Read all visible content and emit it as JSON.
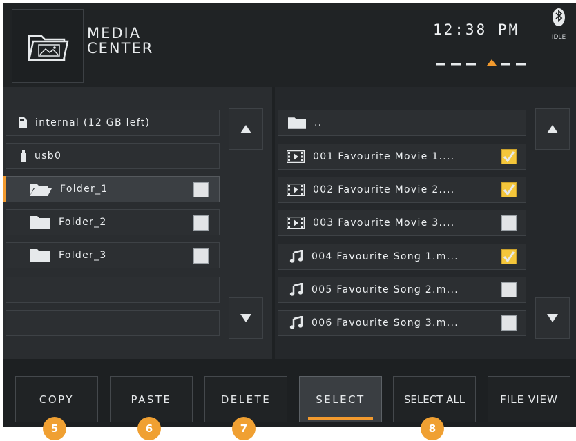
{
  "header": {
    "title_line1": "MEDIA",
    "title_line2": "CENTER",
    "time": "12:38 PM",
    "bluetooth_status": "IDLE",
    "app_icon": "folder-image-icon"
  },
  "left_panel": {
    "items": [
      {
        "label": "internal (12 GB left)",
        "icon": "sd-card-icon"
      },
      {
        "label": "usb0",
        "icon": "usb-drive-icon"
      },
      {
        "label": "Folder_1",
        "icon": "folder-open-icon",
        "checked": false,
        "active": true
      },
      {
        "label": "Folder_2",
        "icon": "folder-icon",
        "checked": false
      },
      {
        "label": "Folder_3",
        "icon": "folder-icon",
        "checked": false
      }
    ]
  },
  "right_panel": {
    "parent_label": "..",
    "items": [
      {
        "label": "001 Favourite Movie 1....",
        "icon": "movie-icon",
        "checked": true
      },
      {
        "label": "002 Favourite Movie 2....",
        "icon": "movie-icon",
        "checked": true
      },
      {
        "label": "003 Favourite Movie 3....",
        "icon": "movie-icon",
        "checked": false
      },
      {
        "label": "004 Favourite Song 1.m...",
        "icon": "music-note-icon",
        "checked": true
      },
      {
        "label": "005 Favourite Song 2.m...",
        "icon": "music-note-icon",
        "checked": false
      },
      {
        "label": "006 Favourite Song 3.m...",
        "icon": "music-note-icon",
        "checked": false
      }
    ]
  },
  "toolbar": {
    "copy": "COPY",
    "paste": "PASTE",
    "delete": "DELETE",
    "select": "SELECT",
    "select_all": "SELECT ALL",
    "file_view": "FILE VIEW"
  },
  "badges": [
    "5",
    "6",
    "7",
    "8"
  ],
  "colors": {
    "accent": "#f29a2e",
    "badge": "#f0a032",
    "check_on": "#f4c63b"
  }
}
